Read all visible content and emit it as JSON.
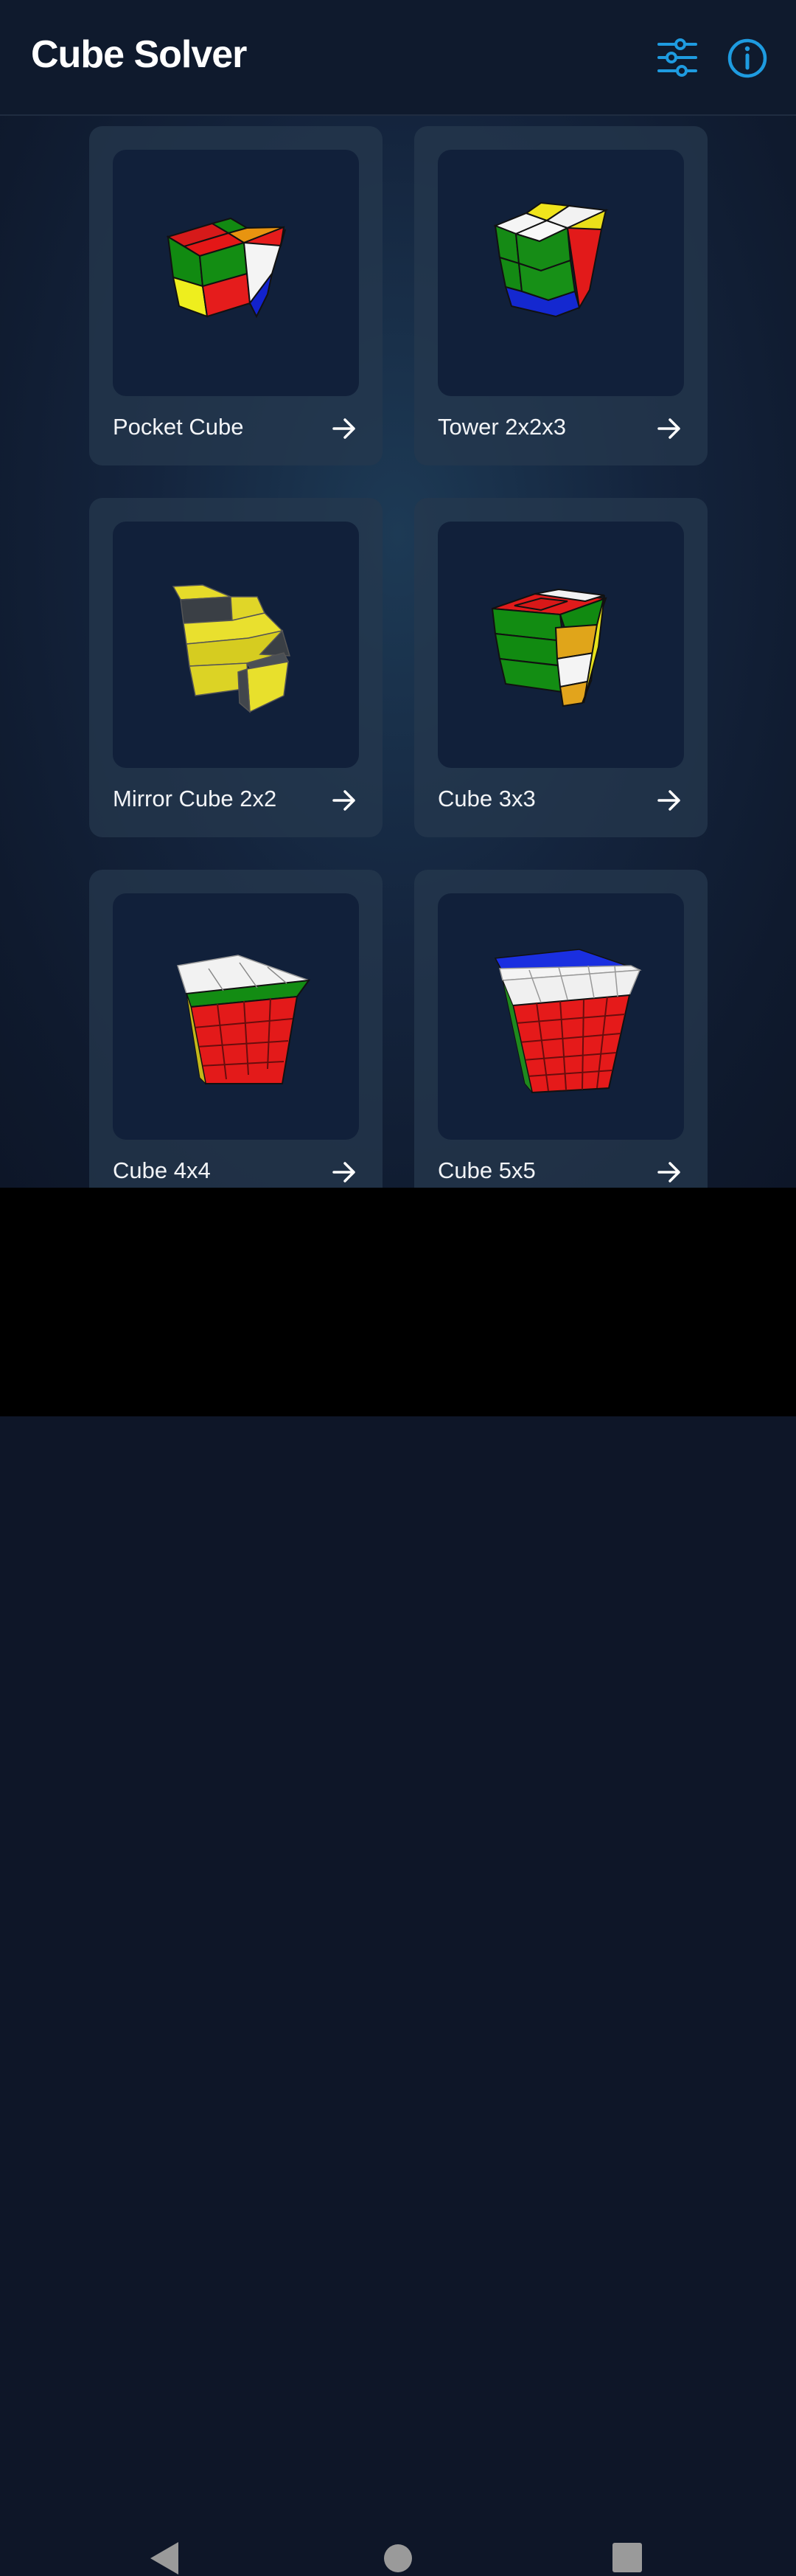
{
  "app": {
    "title": "Cube Solver",
    "actions": [
      {
        "icon": "sliders-icon",
        "name": "settings"
      },
      {
        "icon": "info-icon",
        "name": "info"
      }
    ]
  },
  "colors": {
    "accent": "#1e9be0",
    "card_bg": "#26384e",
    "thumb_bg": "#11203a",
    "text": "#f2f4f7"
  },
  "puzzles": [
    {
      "label": "Pocket Cube",
      "icon": "arrow-right-icon"
    },
    {
      "label": "Tower 2x2x3",
      "icon": "arrow-right-icon"
    },
    {
      "label": "Mirror Cube 2x2",
      "icon": "arrow-right-icon"
    },
    {
      "label": "Cube 3x3",
      "icon": "arrow-right-icon"
    },
    {
      "label": "Cube 4x4",
      "icon": "arrow-right-icon"
    },
    {
      "label": "Cube 5x5",
      "icon": "arrow-right-icon"
    }
  ],
  "system_nav": [
    "back-icon",
    "home-icon",
    "recents-icon"
  ]
}
